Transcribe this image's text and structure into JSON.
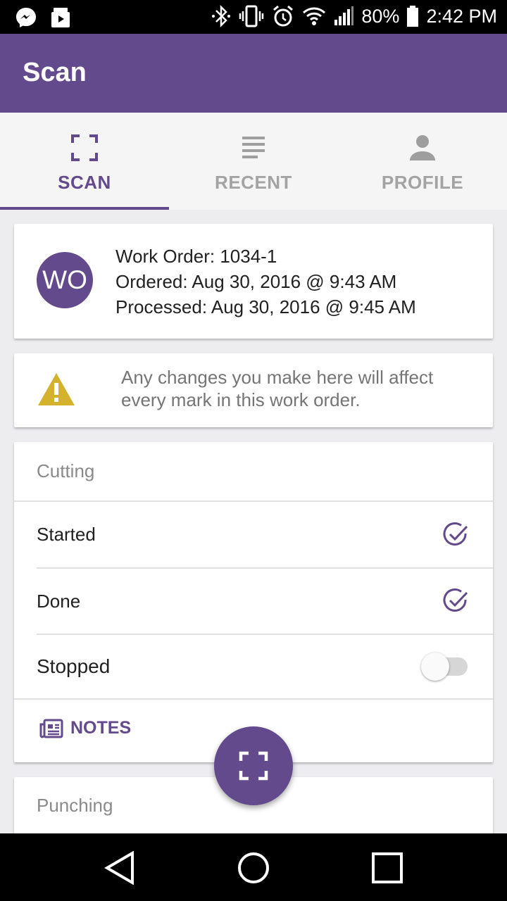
{
  "status_bar": {
    "battery": "80%",
    "time": "2:42 PM",
    "icons": [
      "messenger-icon",
      "media-icon",
      "bluetooth-icon",
      "vibrate-icon",
      "alarm-icon",
      "wifi-icon",
      "signal-icon",
      "battery-icon"
    ]
  },
  "app_bar": {
    "title": "Scan"
  },
  "tabs": [
    {
      "label": "SCAN",
      "icon": "scan-icon",
      "active": true
    },
    {
      "label": "RECENT",
      "icon": "list-icon",
      "active": false
    },
    {
      "label": "PROFILE",
      "icon": "person-icon",
      "active": false
    }
  ],
  "work_order": {
    "avatar": "WO",
    "number_line": "Work Order: 1034-1",
    "ordered_line": "Ordered: Aug 30, 2016 @ 9:43 AM",
    "processed_line": "Processed: Aug 30, 2016 @ 9:45 AM"
  },
  "warning": {
    "icon": "warning-icon",
    "text": "Any changes you make here will affect every mark in this work order."
  },
  "cutting": {
    "title": "Cutting",
    "rows": [
      {
        "label": "Started",
        "state": "checked"
      },
      {
        "label": "Done",
        "state": "checked"
      },
      {
        "label": "Stopped",
        "state": "off"
      }
    ],
    "notes_label": "NOTES"
  },
  "punching": {
    "title": "Punching"
  },
  "fab": {
    "icon": "scan-icon"
  },
  "nav_bar": {
    "icons": [
      "back-icon",
      "home-icon",
      "recents-icon"
    ]
  },
  "colors": {
    "primary": "#634a8c",
    "warning": "#d4b22e",
    "inactive": "#a3a3a3"
  }
}
